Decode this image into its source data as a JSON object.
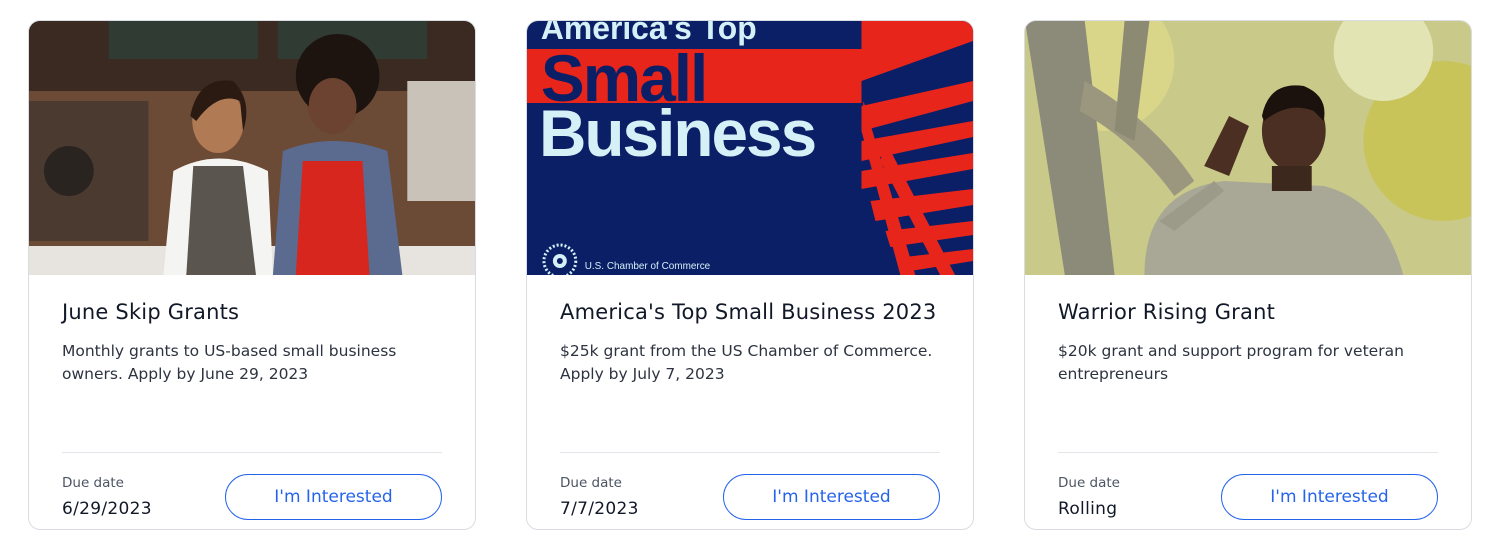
{
  "cards": [
    {
      "title": "June Skip Grants",
      "description": "Monthly grants to US-based small business owners. Apply by June 29, 2023",
      "due_label": "Due date",
      "due_value": "6/29/2023",
      "button_label": "I'm Interested"
    },
    {
      "title": "America's Top Small Business 2023",
      "description": "$25k grant from the US Chamber of Commerce. Apply by July 7, 2023",
      "due_label": "Due date",
      "due_value": "7/7/2023",
      "button_label": "I'm Interested",
      "image_text": {
        "line1": "America's Top",
        "line2": "Small",
        "line3": "Business",
        "org": "U.S. Chamber of Commerce"
      }
    },
    {
      "title": "Warrior Rising Grant",
      "description": "$20k grant and support program for veteran entrepreneurs",
      "due_label": "Due date",
      "due_value": "Rolling",
      "button_label": "I'm Interested"
    }
  ],
  "colors": {
    "accent": "#2563eb",
    "navy": "#0b1f66",
    "red": "#e8251b"
  }
}
